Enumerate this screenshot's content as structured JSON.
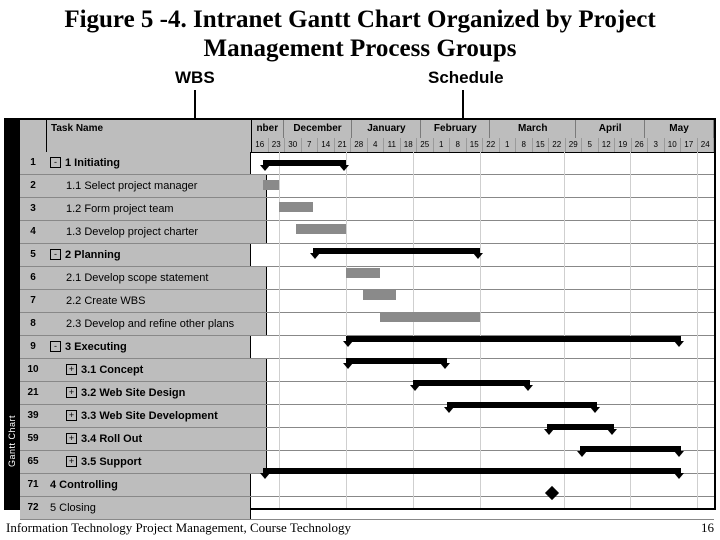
{
  "title": "Figure 5 -4. Intranet Gantt Chart Organized by Project Management Process Groups",
  "labels": {
    "wbs": "WBS",
    "schedule": "Schedule"
  },
  "sidebar": "Gantt Chart",
  "header": {
    "taskname": "Task Name",
    "months": [
      "nber",
      "December",
      "January",
      "February",
      "March",
      "April",
      "May"
    ],
    "weeks": [
      "16",
      "23",
      "30",
      "7",
      "14",
      "21",
      "28",
      "4",
      "11",
      "18",
      "25",
      "1",
      "8",
      "15",
      "22",
      "1",
      "8",
      "15",
      "22",
      "29",
      "5",
      "12",
      "19",
      "26",
      "3",
      "10",
      "17",
      "24"
    ]
  },
  "tasks": [
    {
      "id": "1",
      "name": "1 Initiating",
      "bold": true,
      "exp": "-",
      "ind": 0
    },
    {
      "id": "2",
      "name": "1.1 Select project manager",
      "ind": 1
    },
    {
      "id": "3",
      "name": "1.2 Form project team",
      "ind": 1
    },
    {
      "id": "4",
      "name": "1.3 Develop project charter",
      "ind": 1
    },
    {
      "id": "5",
      "name": "2 Planning",
      "bold": true,
      "exp": "-",
      "ind": 0
    },
    {
      "id": "6",
      "name": "2.1 Develop scope statement",
      "ind": 1
    },
    {
      "id": "7",
      "name": "2.2 Create WBS",
      "ind": 1
    },
    {
      "id": "8",
      "name": "2.3 Develop and refine other plans",
      "ind": 1
    },
    {
      "id": "9",
      "name": "3 Executing",
      "bold": true,
      "exp": "-",
      "ind": 0
    },
    {
      "id": "10",
      "name": "3.1 Concept",
      "bold": true,
      "exp": "+",
      "ind": 1
    },
    {
      "id": "21",
      "name": "3.2 Web Site Design",
      "bold": true,
      "exp": "+",
      "ind": 1
    },
    {
      "id": "39",
      "name": "3.3 Web Site Development",
      "bold": true,
      "exp": "+",
      "ind": 1
    },
    {
      "id": "59",
      "name": "3.4 Roll Out",
      "bold": true,
      "exp": "+",
      "ind": 1
    },
    {
      "id": "65",
      "name": "3.5 Support",
      "bold": true,
      "exp": "+",
      "ind": 1
    },
    {
      "id": "71",
      "name": "4 Controlling",
      "bold": true,
      "ind": 0
    },
    {
      "id": "72",
      "name": "5 Closing",
      "ind": 0
    }
  ],
  "footer": {
    "left": "Information Technology Project Management, Course Technology",
    "right": "16"
  },
  "chart_data": {
    "type": "gantt",
    "title": "Intranet Gantt Chart Organized by Project Management Process Groups",
    "x_axis": {
      "unit": "week",
      "months": [
        "November",
        "December",
        "January",
        "February",
        "March",
        "April",
        "May"
      ]
    },
    "tasks": [
      {
        "id": 1,
        "name": "1 Initiating",
        "type": "summary",
        "start": "Nov-23",
        "end": "Dec-28"
      },
      {
        "id": 2,
        "name": "1.1 Select project manager",
        "type": "bar",
        "start": "Nov-23",
        "end": "Nov-30"
      },
      {
        "id": 3,
        "name": "1.2 Form project team",
        "type": "bar",
        "start": "Nov-30",
        "end": "Dec-14"
      },
      {
        "id": 4,
        "name": "1.3 Develop project charter",
        "type": "bar",
        "start": "Dec-07",
        "end": "Dec-28"
      },
      {
        "id": 5,
        "name": "2 Planning",
        "type": "summary",
        "start": "Dec-14",
        "end": "Feb-22"
      },
      {
        "id": 6,
        "name": "2.1 Develop scope statement",
        "type": "bar",
        "start": "Dec-28",
        "end": "Jan-11"
      },
      {
        "id": 7,
        "name": "2.2 Create WBS",
        "type": "bar",
        "start": "Jan-04",
        "end": "Jan-18"
      },
      {
        "id": 8,
        "name": "2.3 Develop and refine other plans",
        "type": "bar",
        "start": "Jan-11",
        "end": "Feb-22"
      },
      {
        "id": 9,
        "name": "3 Executing",
        "type": "summary",
        "start": "Dec-28",
        "end": "May-17"
      },
      {
        "id": 10,
        "name": "3.1 Concept",
        "type": "summary",
        "start": "Dec-28",
        "end": "Feb-08"
      },
      {
        "id": 21,
        "name": "3.2 Web Site Design",
        "type": "summary",
        "start": "Jan-25",
        "end": "Mar-15"
      },
      {
        "id": 39,
        "name": "3.3 Web Site Development",
        "type": "summary",
        "start": "Feb-08",
        "end": "Apr-12"
      },
      {
        "id": 59,
        "name": "3.4 Roll Out",
        "type": "summary",
        "start": "Mar-22",
        "end": "Apr-19"
      },
      {
        "id": 65,
        "name": "3.5 Support",
        "type": "summary",
        "start": "Apr-05",
        "end": "May-17"
      },
      {
        "id": 71,
        "name": "4 Controlling",
        "type": "summary",
        "start": "Nov-23",
        "end": "May-17"
      },
      {
        "id": 72,
        "name": "5 Closing",
        "type": "milestone",
        "start": "Mar-22"
      }
    ]
  }
}
